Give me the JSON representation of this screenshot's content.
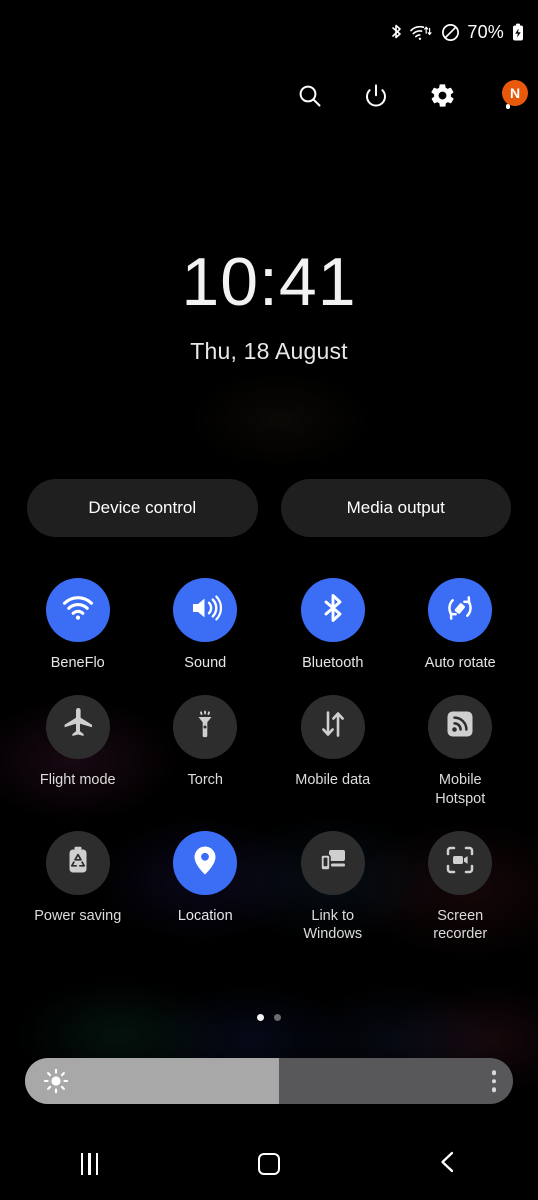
{
  "status_bar": {
    "battery_percent": "70%",
    "icons": [
      "bluetooth-icon",
      "wifi-data-icon",
      "mute-icon",
      "battery-charging-icon"
    ]
  },
  "toolbar": {
    "search_label": "search-icon",
    "power_label": "power-icon",
    "settings_label": "gear-icon",
    "more_label": "kebab-menu-icon",
    "badge_text": "N",
    "badge_color": "#e8590c"
  },
  "clock": {
    "time": "10:41",
    "date": "Thu, 18 August"
  },
  "pills": [
    {
      "label": "Device control",
      "name": "device-control-button"
    },
    {
      "label": "Media output",
      "name": "media-output-button"
    }
  ],
  "tiles": [
    {
      "label": "BeneFlo",
      "icon": "wifi-icon",
      "active": true,
      "name": "tile-wifi"
    },
    {
      "label": "Sound",
      "icon": "volume-icon",
      "active": true,
      "name": "tile-sound"
    },
    {
      "label": "Bluetooth",
      "icon": "bluetooth-icon",
      "active": true,
      "name": "tile-bluetooth"
    },
    {
      "label": "Auto rotate",
      "icon": "auto-rotate-icon",
      "active": true,
      "name": "tile-auto-rotate"
    },
    {
      "label": "Flight mode",
      "icon": "airplane-icon",
      "active": false,
      "name": "tile-flight-mode"
    },
    {
      "label": "Torch",
      "icon": "flashlight-icon",
      "active": false,
      "name": "tile-torch"
    },
    {
      "label": "Mobile data",
      "icon": "data-arrows-icon",
      "active": false,
      "name": "tile-mobile-data"
    },
    {
      "label": "Mobile Hotspot",
      "icon": "hotspot-icon",
      "active": false,
      "name": "tile-mobile-hotspot"
    },
    {
      "label": "Power saving",
      "icon": "battery-eco-icon",
      "active": false,
      "name": "tile-power-saving"
    },
    {
      "label": "Location",
      "icon": "location-pin-icon",
      "active": true,
      "name": "tile-location"
    },
    {
      "label": "Link to Windows",
      "icon": "link-to-windows-icon",
      "active": false,
      "name": "tile-link-to-windows"
    },
    {
      "label": "Screen recorder",
      "icon": "screen-recorder-icon",
      "active": false,
      "name": "tile-screen-recorder"
    }
  ],
  "page_dots": {
    "total": 2,
    "active_index": 0
  },
  "brightness": {
    "percent": 52,
    "sun_icon": "brightness-sun-icon",
    "menu_icon": "kebab-menu-icon"
  },
  "nav_bar": {
    "recents_label": "recents-icon",
    "home_label": "home-icon",
    "back_label": "back-icon"
  },
  "colors": {
    "active_tile": "#3b6ef5",
    "inactive_tile": "#2d2d2d",
    "background": "#000000"
  }
}
